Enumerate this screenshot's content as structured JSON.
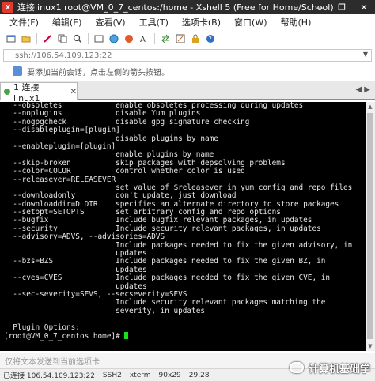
{
  "window": {
    "title": "连接linux1    root@VM_0_7_centos:/home - Xshell 5 (Free for Home/School)",
    "app_icon_text": "X",
    "controls": [
      "—",
      "❐",
      "✕"
    ]
  },
  "menu": {
    "items": [
      "文件(F)",
      "编辑(E)",
      "查看(V)",
      "工具(T)",
      "选项卡(B)",
      "窗口(W)",
      "帮助(H)"
    ]
  },
  "toolbar": {
    "icons": [
      "new-session-icon",
      "open-folder-icon",
      "disconnect-icon",
      "copy-icon",
      "search-icon",
      "fullscreen-icon",
      "globe-icon",
      "color-icon",
      "font-icon",
      "transfer-icon",
      "compose-icon",
      "lock-icon",
      "help-icon"
    ]
  },
  "address": {
    "value": "ssh://106.54.109.123:22"
  },
  "hint": {
    "text": "要添加当前会话，点击左侧的箭头按钮。"
  },
  "tabs": [
    {
      "label": "1 连接linux1",
      "active": true
    }
  ],
  "terminal": {
    "lines": [
      "  --obsoletes            enable obsoletes processing during updates",
      "  --noplugins            disable Yum plugins",
      "  --nogpgcheck           disable gpg signature checking",
      "  --disableplugin=[plugin]",
      "                         disable plugins by name",
      "  --enableplugin=[plugin]",
      "                         enable plugins by name",
      "  --skip-broken          skip packages with depsolving problems",
      "  --color=COLOR          control whether color is used",
      "  --releasever=RELEASEVER",
      "                         set value of $releasever in yum config and repo files",
      "  --downloadonly         don't update, just download",
      "  --downloaddir=DLDIR    specifies an alternate directory to store packages",
      "  --setopt=SETOPTS       set arbitrary config and repo options",
      "  --bugfix               Include bugfix relevant packages, in updates",
      "  --security             Include security relevant packages, in updates",
      "  --advisory=ADVS, --advisories=ADVS",
      "                         Include packages needed to fix the given advisory, in",
      "                         updates",
      "  --bzs=BZS              Include packages needed to fix the given BZ, in",
      "                         updates",
      "  --cves=CVES            Include packages needed to fix the given CVE, in",
      "                         updates",
      "  --sec-severity=SEVS, --secseverity=SEVS",
      "                         Include security relevant packages matching the",
      "                         severity, in updates",
      "",
      "  Plugin Options:"
    ],
    "prompt": "[root@VM_0_7_centos home]# "
  },
  "input_bar": {
    "placeholder": "仅将文本发送到当前选项卡"
  },
  "status": {
    "connection": "已连接 106.54.109.123:22",
    "protocol": "SSH2",
    "terminal_type": "xterm",
    "size": "90x29",
    "position": "29,28"
  },
  "watermark": {
    "text": "计算机基础学"
  },
  "colors": {
    "terminal_bg": "#000000",
    "terminal_fg": "#e8e8e8",
    "cursor": "#1ae01a",
    "titlebar_bg": "#2c2c2c",
    "tab_accent": "#6c8fc4"
  }
}
